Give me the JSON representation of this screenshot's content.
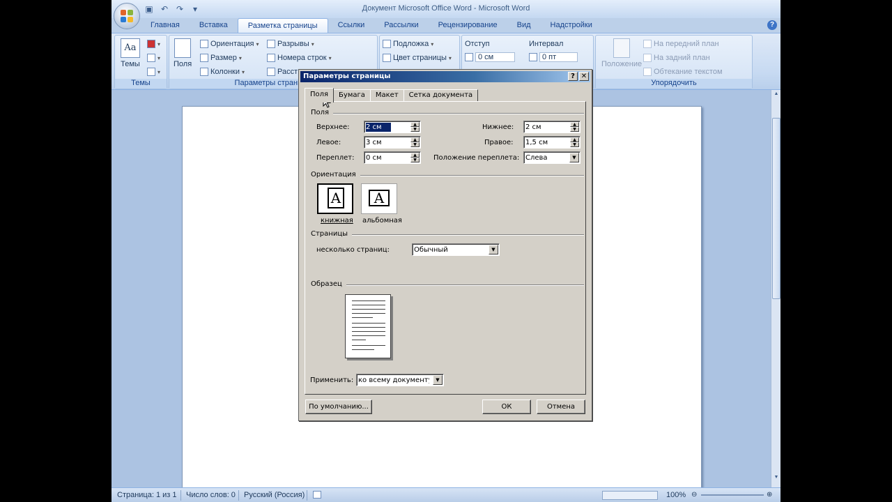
{
  "window": {
    "title": "Документ Microsoft Office Word - Microsoft Word",
    "help_symbol": "?"
  },
  "tabs": [
    "Главная",
    "Вставка",
    "Разметка страницы",
    "Ссылки",
    "Рассылки",
    "Рецензирование",
    "Вид",
    "Надстройки"
  ],
  "active_tab_index": 2,
  "ribbon": {
    "themes": {
      "label": "Темы",
      "button": "Темы"
    },
    "page_setup": {
      "label": "Параметры страницы",
      "fields": "Поля",
      "orientation": "Ориентация",
      "size": "Размер",
      "columns": "Колонки",
      "breaks": "Разрывы",
      "line_numbers": "Номера строк",
      "hyphenation": "Расст"
    },
    "background": {
      "watermark": "Подложка",
      "page_color": "Цвет страницы"
    },
    "paragraph": {
      "indent": "Отступ",
      "spacing": "Интервал",
      "indent_value": "0 см",
      "spacing_value": "0 пт"
    },
    "arrange": {
      "label": "Упорядочить",
      "position": "Положение",
      "bring_front": "На передний план",
      "send_back": "На задний план",
      "text_wrap": "Обтекание текстом"
    }
  },
  "statusbar": {
    "page": "Страница: 1 из 1",
    "words": "Число слов: 0",
    "language": "Русский (Россия)",
    "zoom": "100%"
  },
  "dialog": {
    "title": "Параметры страницы",
    "tabs": [
      "Поля",
      "Бумага",
      "Макет",
      "Сетка документа"
    ],
    "active_tab_index": 0,
    "margins_section": "Поля",
    "top_label": "Верхнее:",
    "top_value": "2 см",
    "bottom_label": "Нижнее:",
    "bottom_value": "2 см",
    "left_label": "Левое:",
    "left_value": "3 см",
    "right_label": "Правое:",
    "right_value": "1,5 см",
    "gutter_label": "Переплет:",
    "gutter_value": "0 см",
    "gutter_pos_label": "Положение переплета:",
    "gutter_pos_value": "Слева",
    "orientation_section": "Ориентация",
    "portrait": "книжная",
    "landscape": "альбомная",
    "orientation_letter": "A",
    "pages_section": "Страницы",
    "multiple_pages_label": "несколько страниц:",
    "multiple_pages_value": "Обычный",
    "preview_section": "Образец",
    "apply_label": "Применить:",
    "apply_value": "ко всему документу",
    "default_button": "По умолчанию...",
    "ok_button": "ОК",
    "cancel_button": "Отмена"
  }
}
